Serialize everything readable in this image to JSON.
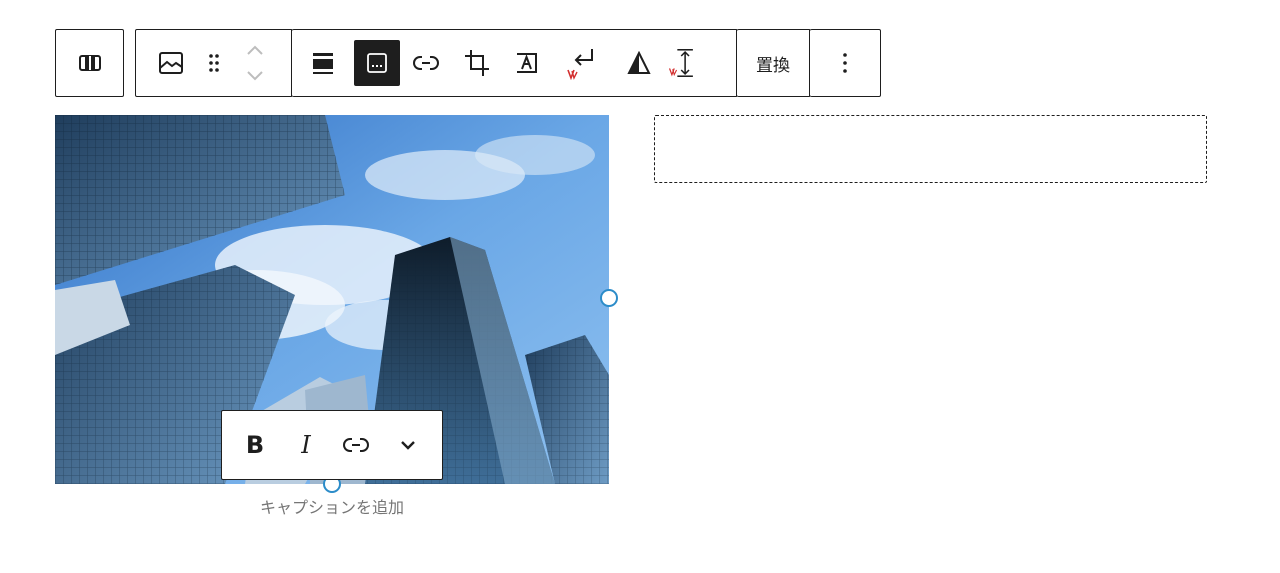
{
  "block_toolbar": {
    "groups": [
      {
        "items": [
          {
            "name": "columns-icon"
          }
        ]
      },
      {
        "items": [
          {
            "name": "image-icon"
          },
          {
            "name": "drag-handle-icon"
          },
          {
            "name": "move-up-down-icon"
          }
        ]
      },
      {
        "items": [
          {
            "name": "align-icon"
          },
          {
            "name": "caption-icon",
            "active": true
          },
          {
            "name": "link-icon"
          },
          {
            "name": "crop-icon"
          },
          {
            "name": "text-over-image-icon"
          },
          {
            "name": "wrap-icon"
          },
          {
            "name": "triangle-icon"
          },
          {
            "name": "height-icon"
          }
        ]
      },
      {
        "items": [
          {
            "name": "replace-button"
          }
        ]
      },
      {
        "items": [
          {
            "name": "more-options-icon"
          }
        ]
      }
    ],
    "replace_label": "置換"
  },
  "image": {
    "alt": "高層ビル群"
  },
  "caption": {
    "placeholder": "キャプションを追加"
  },
  "text_toolbar": {
    "bold_label": "B",
    "italic_label": "I"
  },
  "colors": {
    "accent": "#2c8cc9",
    "border": "#1e1e1e",
    "active_bg": "#1e1e1e"
  }
}
